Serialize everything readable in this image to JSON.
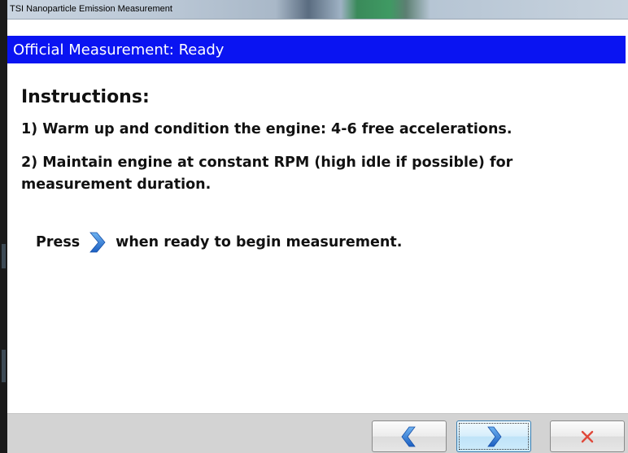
{
  "window": {
    "title": "TSI Nanoparticle Emission Measurement"
  },
  "status": {
    "text": "Official Measurement: Ready"
  },
  "instructions": {
    "heading": "Instructions:",
    "step1": "1) Warm up and condition the engine: 4-6 free accelerations.",
    "step2": "2) Maintain engine at constant RPM (high idle if possible) for measurement duration.",
    "press_before": "Press",
    "press_after": "when ready to begin measurement."
  },
  "buttons": {
    "back_icon": "chevron-left-icon",
    "next_icon": "chevron-right-icon",
    "cancel_icon": "close-icon"
  },
  "colors": {
    "header_bar": "#0A14F2",
    "chevron": "#1E6FD0",
    "cancel_x": "#E0483A"
  }
}
